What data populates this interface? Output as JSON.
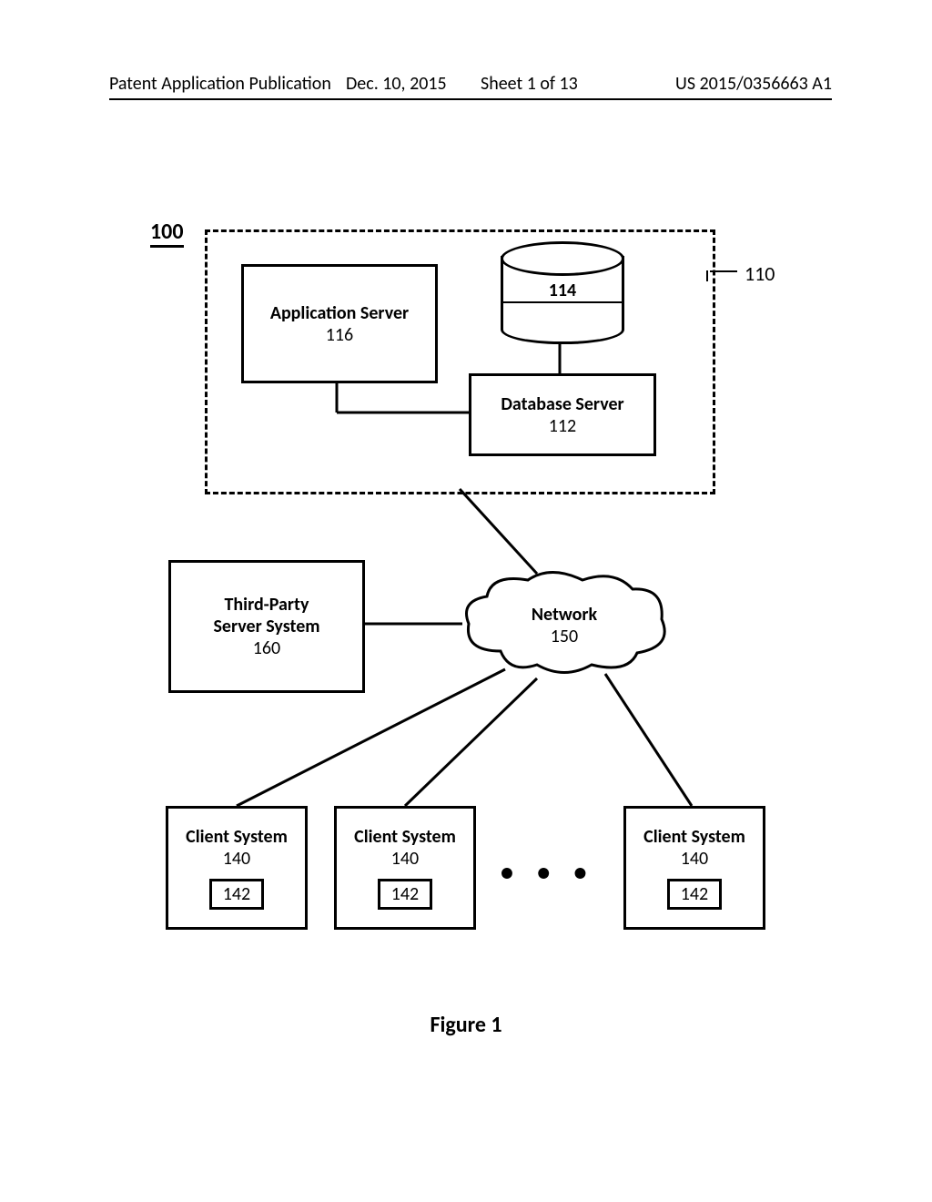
{
  "header": {
    "left": "Patent Application Publication",
    "date": "Dec. 10, 2015",
    "sheet": "Sheet 1 of 13",
    "pubnum": "US 2015/0356663 A1"
  },
  "figure_label": "Figure 1",
  "refs": {
    "system": "100",
    "group": "110"
  },
  "nodes": {
    "app_server": {
      "title": "Application Server",
      "num": "116"
    },
    "db_server": {
      "title": "Database Server",
      "num": "112"
    },
    "database": {
      "num": "114"
    },
    "third_party": {
      "title": "Third-Party\nServer System",
      "num": "160"
    },
    "network": {
      "title": "Network",
      "num": "150"
    },
    "client": {
      "title": "Client System",
      "num": "140",
      "inner": "142"
    }
  },
  "ellipsis": "• • •"
}
